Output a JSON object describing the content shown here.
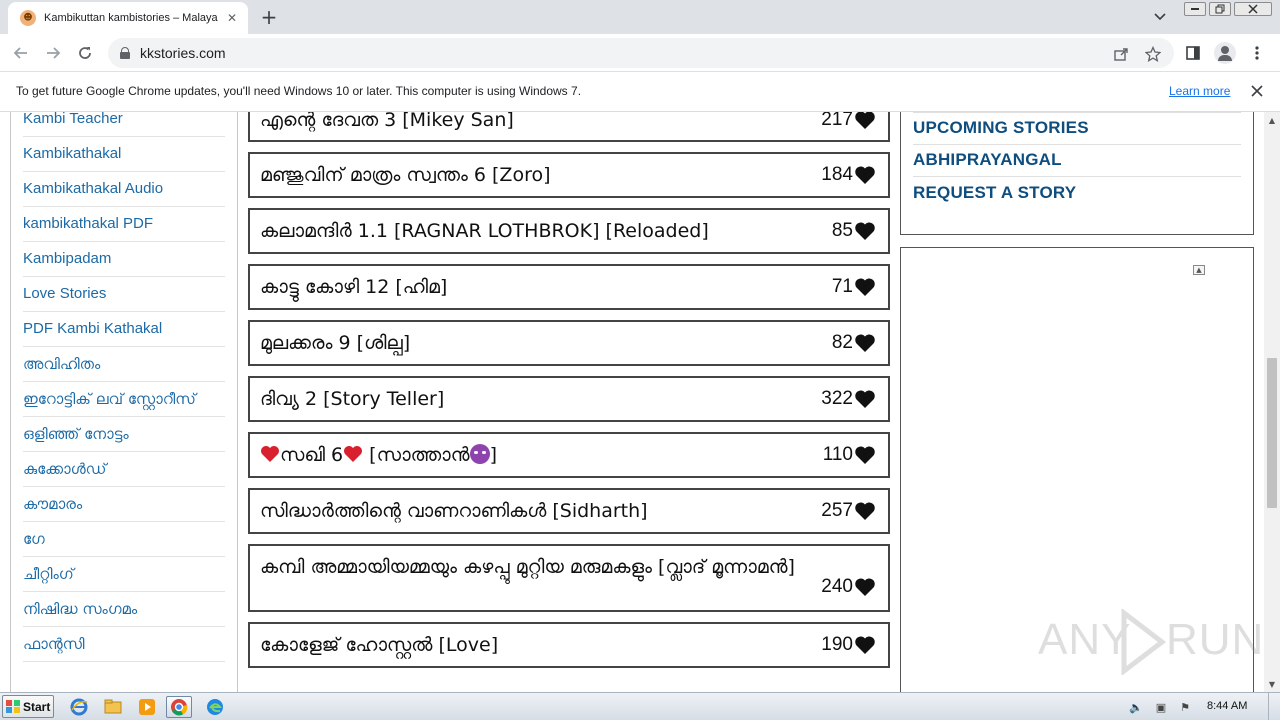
{
  "browser": {
    "tab_title": "Kambikuttan kambistories – Malayalam",
    "url": "kkstories.com",
    "new_tab_glyph": "+",
    "tab_close_glyph": "✕"
  },
  "infobar": {
    "message": "To get future Google Chrome updates, you'll need Windows 10 or later. This computer is using Windows 7.",
    "link": "Learn more"
  },
  "categories": [
    "Kambi Teacher",
    "Kambikathakal",
    "Kambikathakal Audio",
    "kambikathakal PDF",
    "Kambipadam",
    "Love Stories",
    "PDF Kambi Kathakal",
    "അവിഹിതം",
    "ഇറോട്ടിക് ലവ് സ്റ്റോറീസ്",
    "ഒളിഞ്ഞ് നോട്ടം",
    "കുക്കോൾഡ്",
    "കൗമാരം",
    "ഗേ",
    "ചീറ്റിംഗ്",
    "നിഷിദ്ധ സംഗമം",
    "ഫാന്റസി"
  ],
  "stories": [
    {
      "title": "എന്റെ ദേവത 3 [Mikey San]",
      "count": "217"
    },
    {
      "title": "മഞ്ജുവിന് മാത്രം സ്വന്തം 6 [Zoro]",
      "count": "184"
    },
    {
      "title": "കലാമന്ദിർ 1.1 [RAGNAR LOTHBROK] [Reloaded]",
      "count": "85"
    },
    {
      "title": "കാട്ടു കോഴി 12 [ഹിമ]",
      "count": "71"
    },
    {
      "title": "മുലക്കരം 9 [ശില്പ]",
      "count": "82"
    },
    {
      "title": "ദിവ്യ 2 [Story Teller]",
      "count": "322"
    },
    {
      "title_pre": "സഖി 6",
      "title_post": " [സാത്താൻ",
      "title_end": "]",
      "count": "110"
    },
    {
      "title": "സിദ്ധാർത്തിന്റെ വാണറാണികൾ [Sidharth]",
      "count": "257"
    },
    {
      "title": "കമ്പി അമ്മായിയമ്മയും കഴപ്പു മുറ്റിയ മരുമകളും [വ്ലാദ് മൂന്നാമൻ]",
      "count": "240"
    },
    {
      "title": "കോളേജ് ഹോസ്റ്റൽ [Love]",
      "count": "190"
    }
  ],
  "sidebar_links": [
    "UPCOMING STORIES",
    "ABHIPRAYANGAL",
    "REQUEST A STORY"
  ],
  "taskbar": {
    "start_label": "Start",
    "clock": "8:44 AM"
  },
  "watermark": {
    "left": "ANY",
    "right": "RUN"
  },
  "colors": {
    "link_blue": "#1c6aa6",
    "sidebar_link": "#0e4d7e",
    "chrome_frame": "#dee1e6"
  }
}
